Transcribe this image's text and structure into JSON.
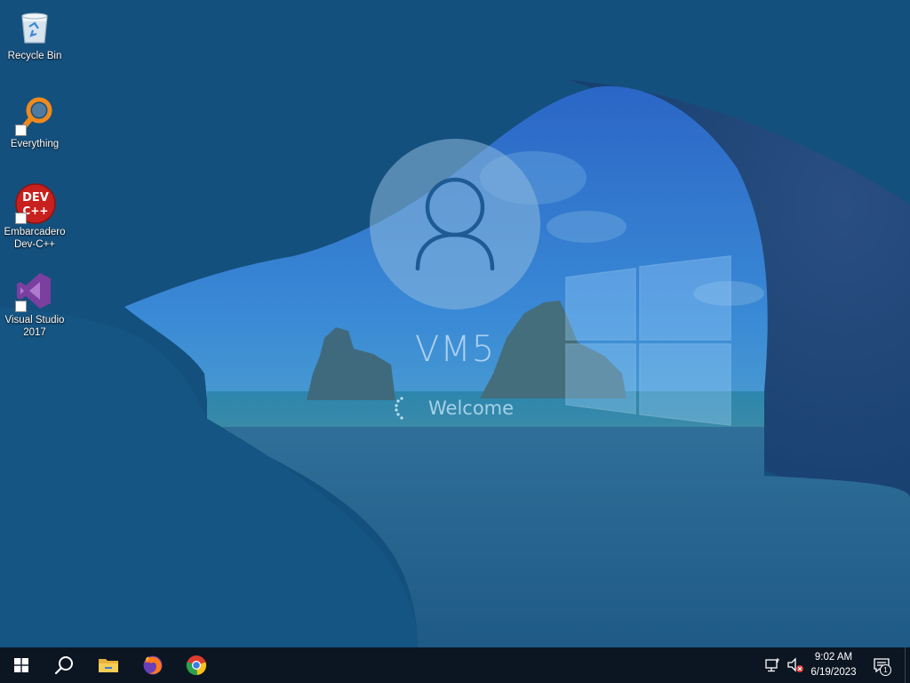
{
  "desktop": {
    "icons": [
      {
        "label": "Recycle Bin",
        "icon": "recycle-bin-icon",
        "shortcut": false
      },
      {
        "label": "Everything",
        "icon": "everything-search-icon",
        "shortcut": true
      },
      {
        "label": "Embarcadero Dev-C++",
        "icon": "devcpp-icon",
        "shortcut": true,
        "badge_text": "DEV C++"
      },
      {
        "label": "Visual Studio 2017",
        "icon": "visual-studio-icon",
        "shortcut": true
      }
    ]
  },
  "login": {
    "username": "VM5",
    "status": "Welcome",
    "avatar_icon": "user-avatar-icon",
    "spinner_icon": "loading-spinner-icon"
  },
  "taskbar": {
    "items": [
      {
        "name": "start",
        "icon": "windows-start-icon"
      },
      {
        "name": "search",
        "icon": "search-icon"
      },
      {
        "name": "file-explorer",
        "icon": "folder-icon"
      },
      {
        "name": "firefox",
        "icon": "firefox-icon"
      },
      {
        "name": "chrome",
        "icon": "chrome-icon"
      }
    ],
    "tray": {
      "network_icon": "network-disconnected-icon",
      "volume_icon": "volume-muted-icon",
      "time": "9:02 AM",
      "date": "6/19/2023",
      "notifications_icon": "action-center-icon",
      "notifications_count": "1"
    }
  },
  "colors": {
    "overlay_blue": "#12507f",
    "taskbar_bg": "#0c1622",
    "sky": "#2a7bd0",
    "dev_red": "#c8201e",
    "vs_purple": "#7a3f9f"
  }
}
